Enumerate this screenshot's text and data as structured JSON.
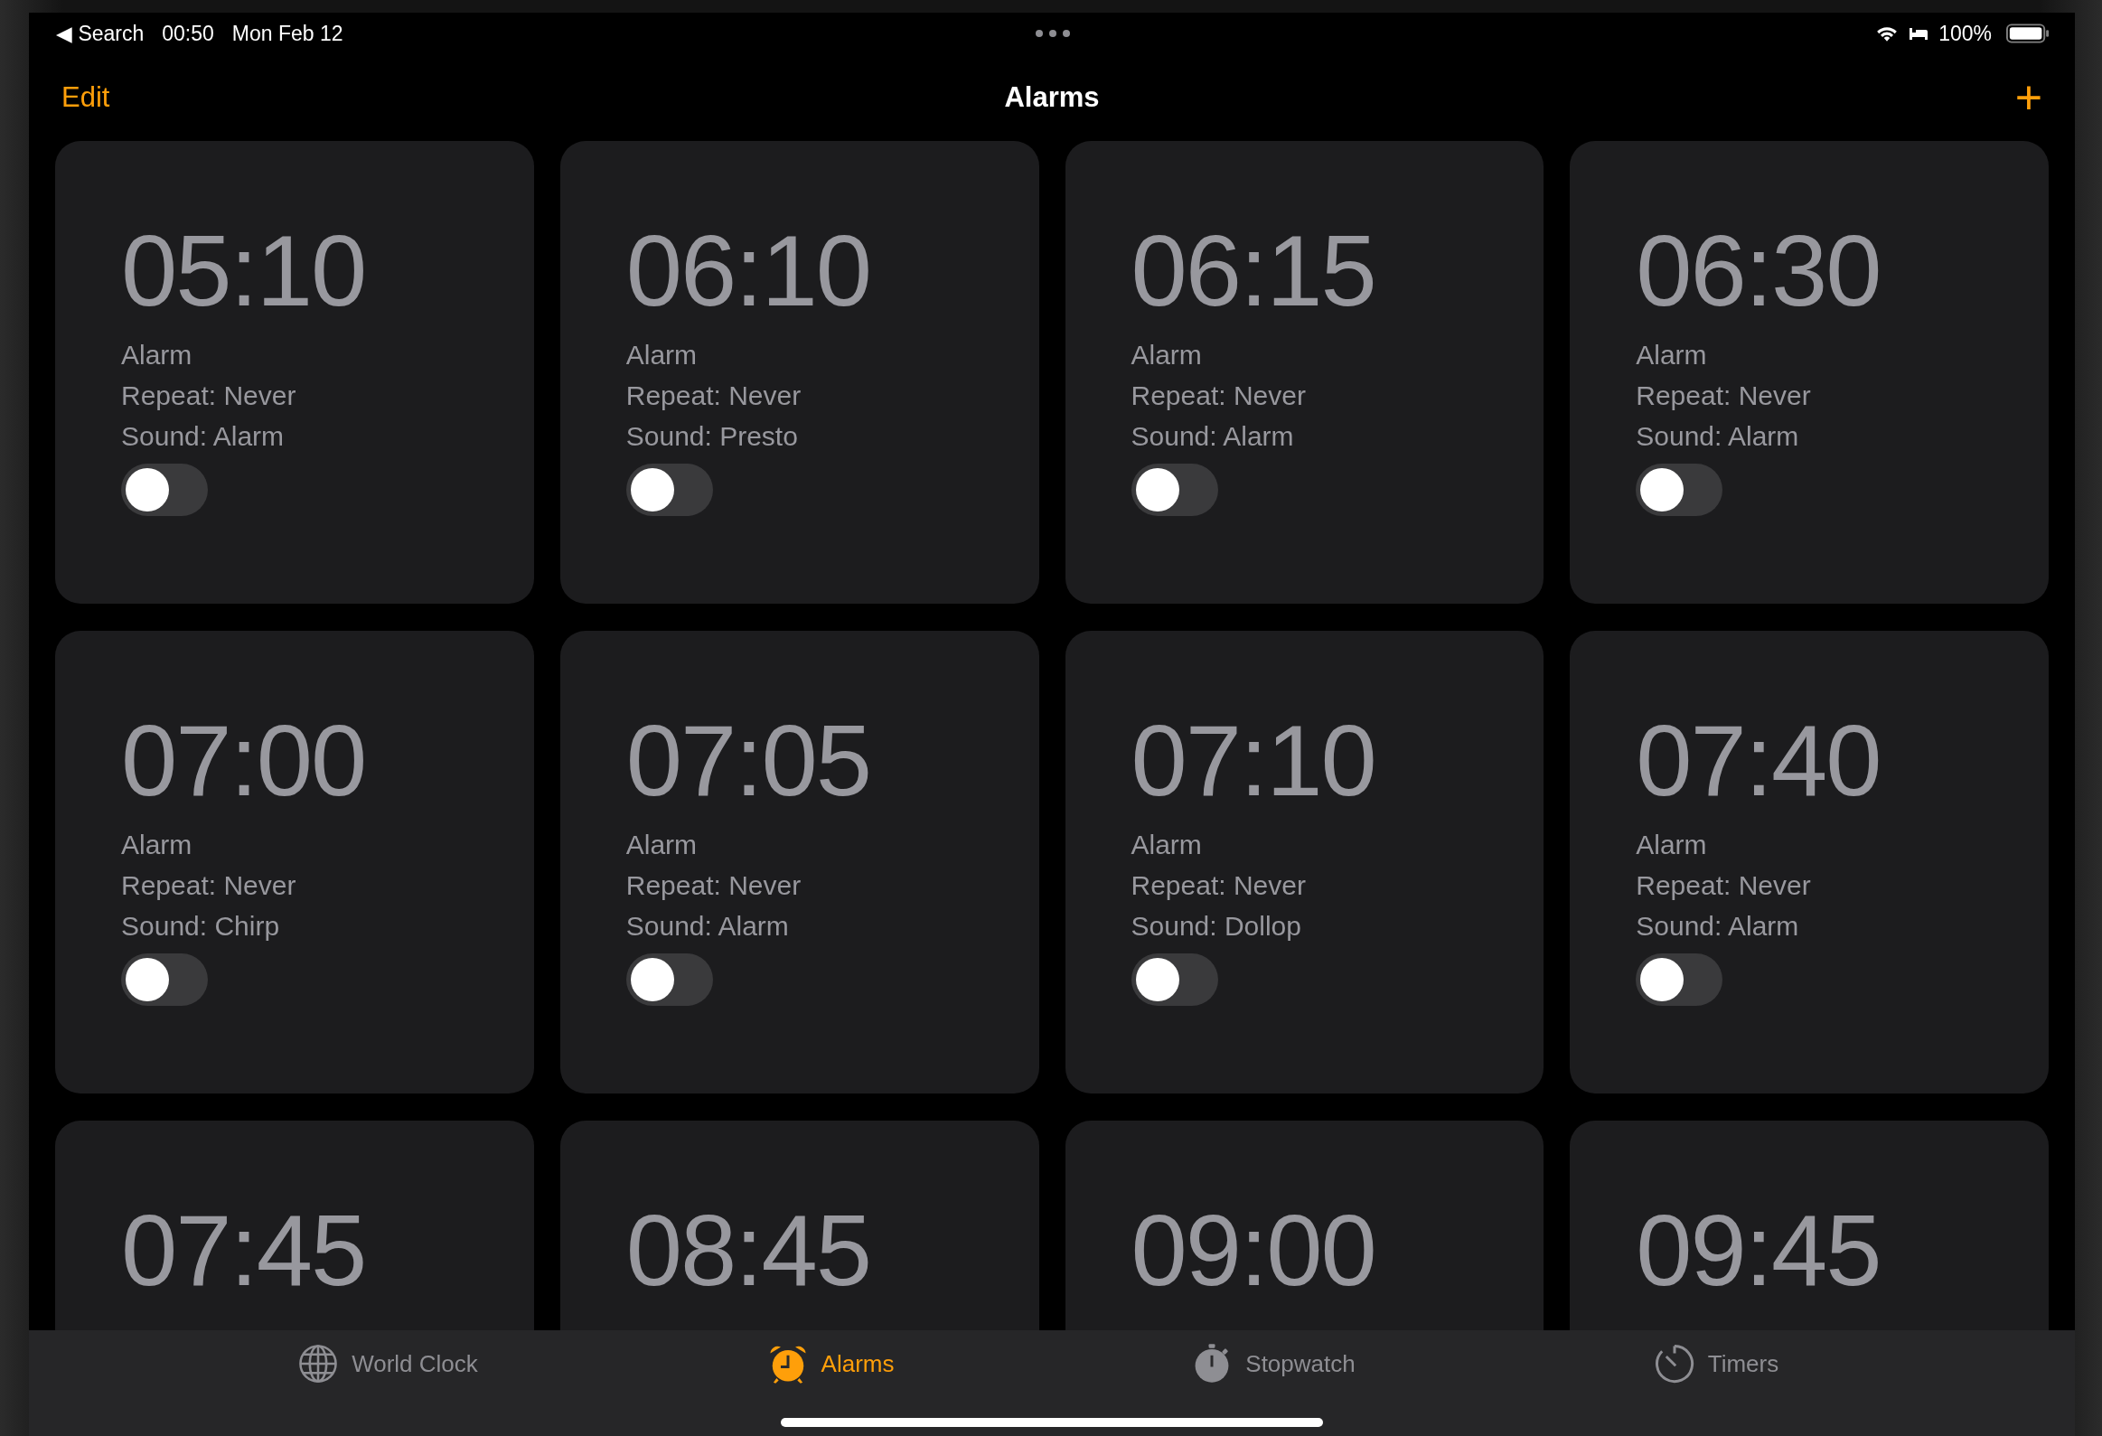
{
  "status_bar": {
    "back": "◀ Search",
    "time": "00:50",
    "date": "Mon Feb 12",
    "battery": "100%"
  },
  "nav": {
    "edit": "Edit",
    "title": "Alarms",
    "add": "+"
  },
  "alarms": [
    {
      "time": "05:10",
      "label": "Alarm",
      "repeat": "Repeat: Never",
      "sound": "Sound: Alarm",
      "on": false
    },
    {
      "time": "06:10",
      "label": "Alarm",
      "repeat": "Repeat: Never",
      "sound": "Sound: Presto",
      "on": false
    },
    {
      "time": "06:15",
      "label": "Alarm",
      "repeat": "Repeat: Never",
      "sound": "Sound: Alarm",
      "on": false
    },
    {
      "time": "06:30",
      "label": "Alarm",
      "repeat": "Repeat: Never",
      "sound": "Sound: Alarm",
      "on": false
    },
    {
      "time": "07:00",
      "label": "Alarm",
      "repeat": "Repeat: Never",
      "sound": "Sound: Chirp",
      "on": false
    },
    {
      "time": "07:05",
      "label": "Alarm",
      "repeat": "Repeat: Never",
      "sound": "Sound: Alarm",
      "on": false
    },
    {
      "time": "07:10",
      "label": "Alarm",
      "repeat": "Repeat: Never",
      "sound": "Sound: Dollop",
      "on": false
    },
    {
      "time": "07:40",
      "label": "Alarm",
      "repeat": "Repeat: Never",
      "sound": "Sound: Alarm",
      "on": false
    },
    {
      "time": "07:45"
    },
    {
      "time": "08:45"
    },
    {
      "time": "09:00"
    },
    {
      "time": "09:45"
    }
  ],
  "tab_bar": [
    {
      "kind": "globe",
      "label": "World Clock",
      "selected": false
    },
    {
      "kind": "alarm",
      "label": "Alarms",
      "selected": true
    },
    {
      "kind": "stopwatch",
      "label": "Stopwatch",
      "selected": false
    },
    {
      "kind": "timer",
      "label": "Timers",
      "selected": false
    }
  ]
}
